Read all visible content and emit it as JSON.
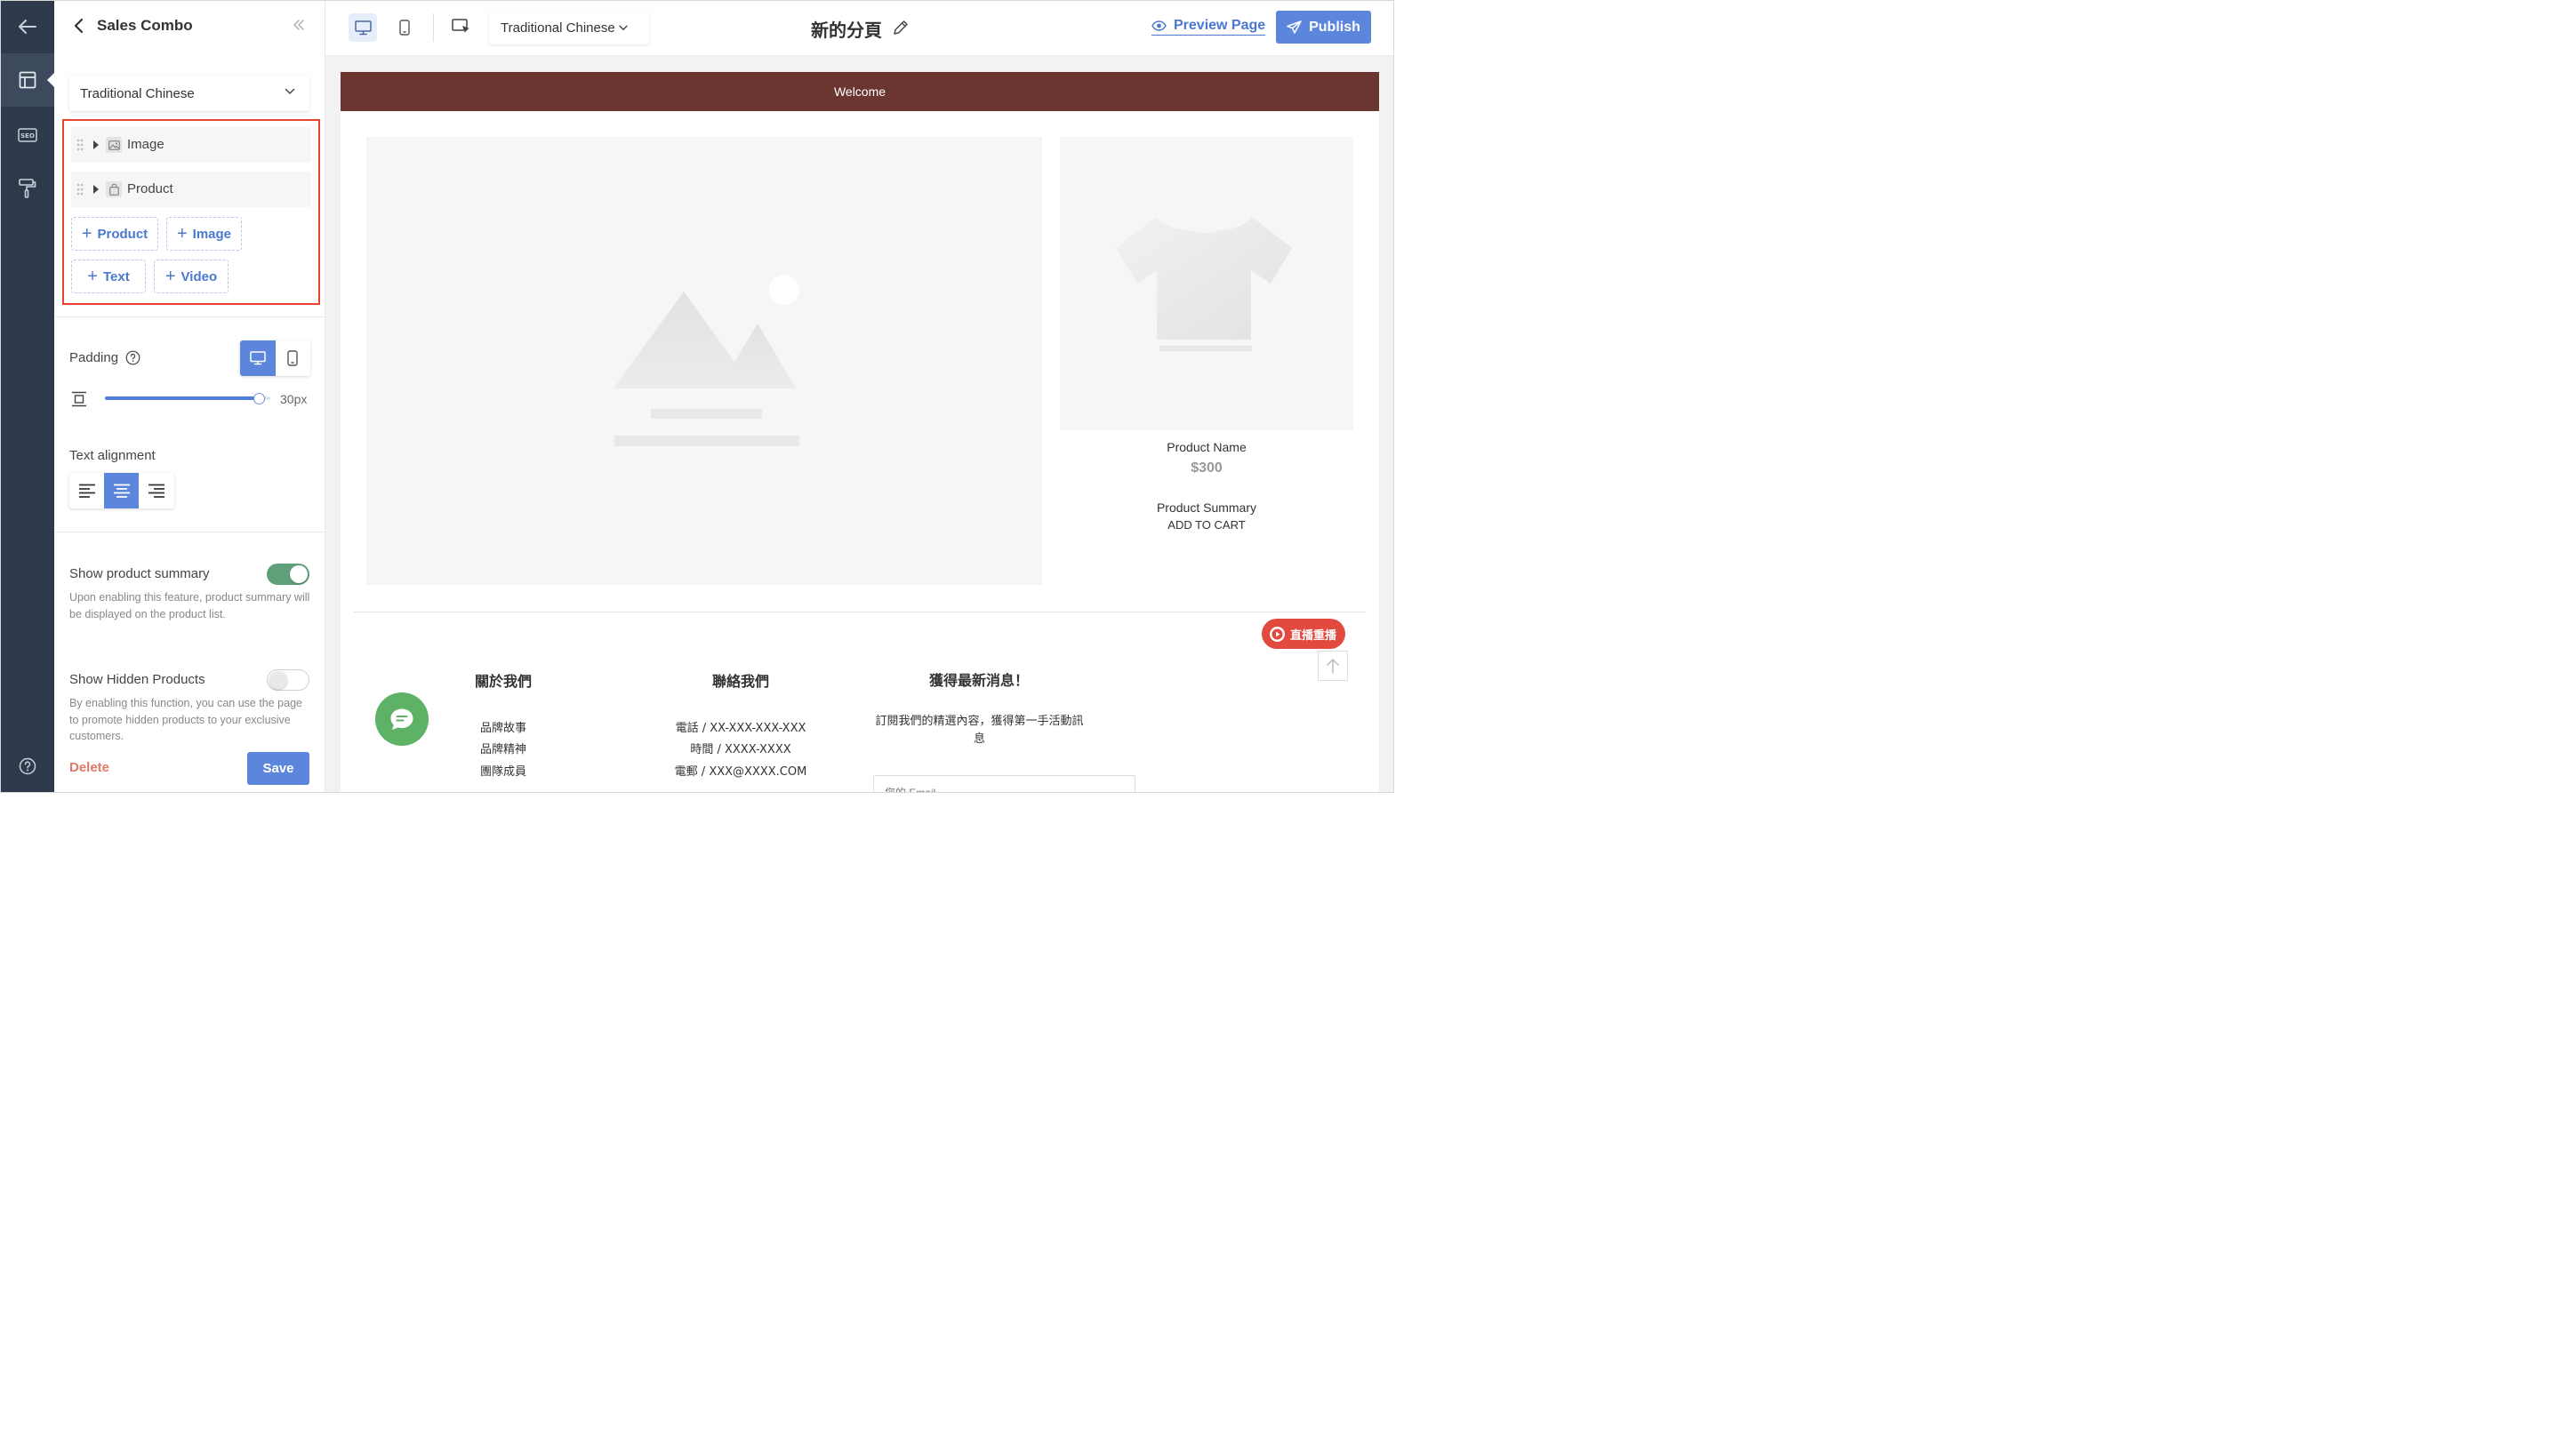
{
  "panel": {
    "title": "Sales Combo",
    "language": "Traditional Chinese",
    "blocks": [
      {
        "label": "Image",
        "icon": "image-icon"
      },
      {
        "label": "Product",
        "icon": "bag-icon"
      }
    ],
    "add_buttons": [
      "Product",
      "Image",
      "Text",
      "Video"
    ],
    "padding_label": "Padding",
    "padding_value": "30px",
    "padding_fraction": 0.93,
    "text_alignment_label": "Text alignment",
    "text_alignment_selected": "center",
    "show_summary": {
      "label": "Show product summary",
      "enabled": true,
      "description": "Upon enabling this feature, product summary will be displayed on the product list."
    },
    "show_hidden": {
      "label": "Show Hidden Products",
      "enabled": false,
      "description": "By enabling this function, you can use the page to promote hidden products to your exclusive customers."
    },
    "delete_label": "Delete",
    "save_label": "Save"
  },
  "toolbar": {
    "language": "Traditional Chinese",
    "page_name": "新的分頁",
    "preview_label": "Preview Page",
    "publish_label": "Publish"
  },
  "canvas": {
    "welcome": "Welcome",
    "product": {
      "name": "Product Name",
      "price": "$300",
      "summary": "Product Summary",
      "add_to_cart": "ADD TO CART"
    },
    "live_badge": "直播重播",
    "footer": {
      "about": {
        "title": "關於我們",
        "links": [
          "品牌故事",
          "品牌精神",
          "團隊成員"
        ]
      },
      "contact": {
        "title": "聯絡我們",
        "links": [
          "電話 / XX-XXX-XXX-XXX",
          "時間 / XXXX-XXXX",
          "電郵 / XXX@XXXX.COM"
        ]
      },
      "news": {
        "title": "獲得最新消息！",
        "text": "訂閱我們的精選內容，獲得第一手活動訊息",
        "email_placeholder": "您的 Email"
      }
    }
  },
  "colors": {
    "accent": "#5b86db",
    "rail": "#2e3a4c",
    "welcome_bar": "#6b3530",
    "highlight_border": "#e8452c",
    "toggle_on": "#5fa07a",
    "live_badge": "#e24a3f",
    "chat": "#5db265"
  }
}
